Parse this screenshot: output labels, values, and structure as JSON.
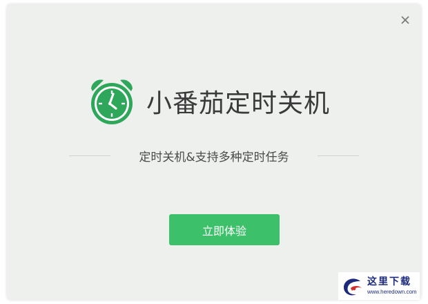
{
  "app": {
    "title": "小番茄定时关机",
    "subtitle": "定时关机&支持多种定时任务",
    "cta_label": "立即体验"
  },
  "icons": {
    "close": "close-icon",
    "logo": "alarm-clock-icon"
  },
  "colors": {
    "accent": "#3cc16a",
    "logo_green": "#2ea75a",
    "background": "#eef0ee",
    "title_text": "#3a3a3a"
  },
  "watermark": {
    "title": "这里下载",
    "url": "www.heredown.com"
  }
}
